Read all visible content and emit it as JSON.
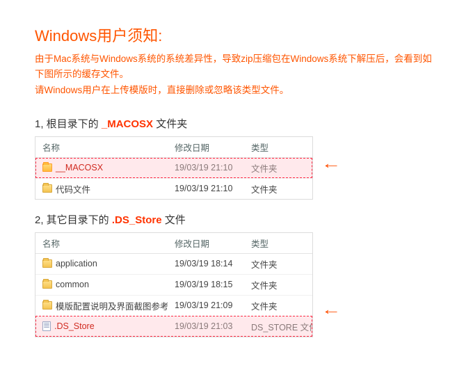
{
  "title": "Windows用户须知:",
  "desc_line1": "由于Mac系统与Windows系统的系统差异性，导致zip压缩包在Windows系统下解压后，会看到如下图所示的缓存文件。",
  "desc_line2": "请Windows用户在上传模版时，直接删除或忽略该类型文件。",
  "section1": {
    "prefix": "1, 根目录下的 ",
    "highlight": "_MACOSX",
    "suffix": " 文件夹"
  },
  "section2": {
    "prefix": "2, 其它目录下的 ",
    "highlight": ".DS_Store",
    "suffix": " 文件"
  },
  "columns": {
    "name": "名称",
    "date": "修改日期",
    "type": "类型"
  },
  "table1": [
    {
      "name": "__MACOSX",
      "date": "19/03/19 21:10",
      "type": "文件夹",
      "hl": true,
      "icon": "folder"
    },
    {
      "name": "代码文件",
      "date": "19/03/19 21:10",
      "type": "文件夹",
      "hl": false,
      "icon": "folder"
    }
  ],
  "table2": [
    {
      "name": "application",
      "date": "19/03/19 18:14",
      "type": "文件夹",
      "hl": false,
      "icon": "folder"
    },
    {
      "name": "common",
      "date": "19/03/19 18:15",
      "type": "文件夹",
      "hl": false,
      "icon": "folder"
    },
    {
      "name": "模版配置说明及界面截图参考",
      "date": "19/03/19 21:09",
      "type": "文件夹",
      "hl": false,
      "icon": "folder"
    },
    {
      "name": ".DS_Store",
      "date": "19/03/19 21:03",
      "type": "DS_STORE 文件",
      "hl": true,
      "icon": "file"
    }
  ],
  "arrow": "←"
}
